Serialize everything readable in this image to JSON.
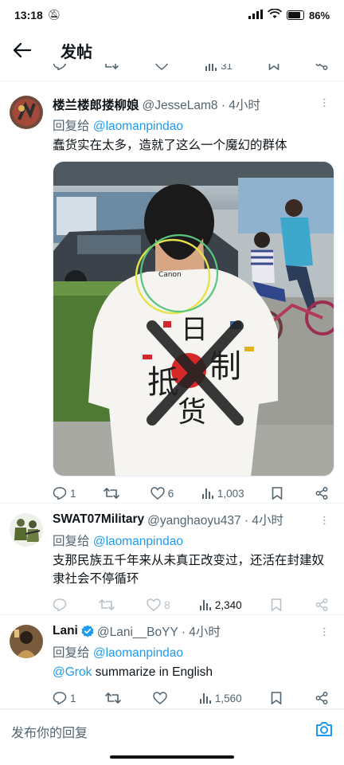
{
  "status_bar": {
    "time": "13:18",
    "battery": "86",
    "battery_level": 0.86
  },
  "header": {
    "title": "发帖"
  },
  "partial_bar": {
    "views": "31"
  },
  "posts": [
    {
      "name": "楼兰楼郎搂柳娘",
      "handle": "@JesseLam8 · 4小时",
      "reply_label": "回复给",
      "reply_mention": "@laomanpindao",
      "text": "蠢货实在太多，造就了这么一个魔幻的群体",
      "photo_text": {
        "shirt_cam": "Canon",
        "glyph1": "日",
        "glyph2": "抵",
        "glyph3": "制",
        "glyph4": "货"
      },
      "replies": "1",
      "retweets": "",
      "likes": "6",
      "views": "1,003"
    },
    {
      "name": "SWAT07Military",
      "handle": "@yanghaoyu437 · 4小时",
      "reply_label": "回复给",
      "reply_mention": "@laomanpindao",
      "text": "支那民族五千年来从未真正改变过，还活在封建奴隶社会不停循环",
      "replies": "",
      "retweets": "",
      "likes": "8",
      "views": "2,340"
    },
    {
      "name": "Lani",
      "handle": "@Lani__BoYY · 4小时",
      "reply_label": "回复给",
      "reply_mention": "@laomanpindao",
      "text_mention": "@Grok",
      "text_rest": " summarize in English",
      "replies": "1",
      "retweets": "",
      "likes": "",
      "views": "1,560"
    }
  ],
  "reply_input": {
    "placeholder": "发布你的回复"
  },
  "icons": [
    "back-arrow-icon",
    "reply-icon",
    "retweet-icon",
    "like-icon",
    "views-icon",
    "bookmark-icon",
    "share-icon",
    "verified-icon",
    "camera-icon",
    "more-icon"
  ],
  "colors": {
    "link": "#1d9bf0",
    "secondary": "#536471",
    "verified": "#1d9bf0"
  }
}
